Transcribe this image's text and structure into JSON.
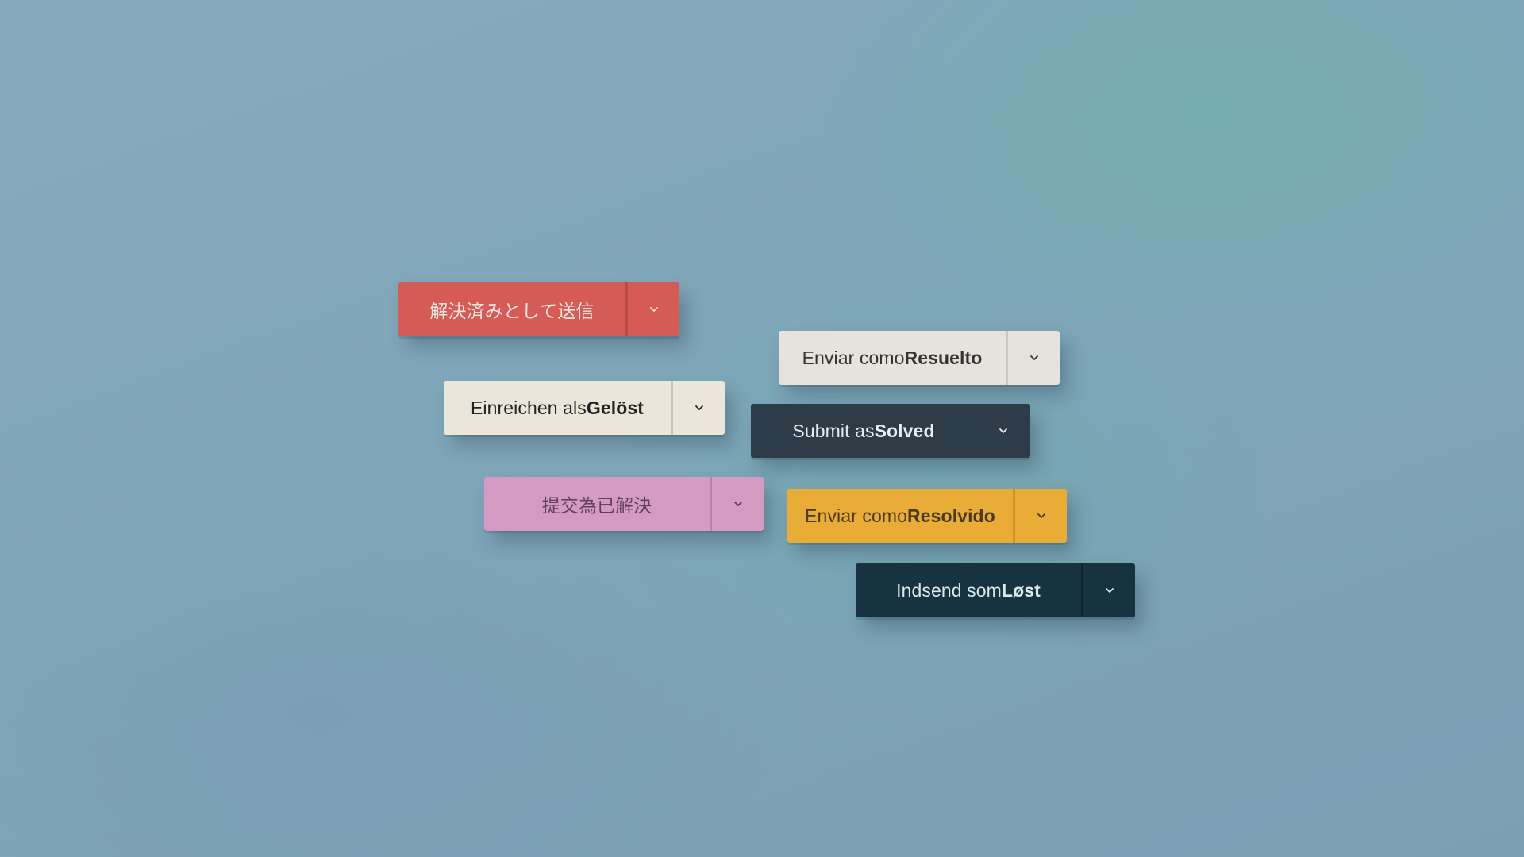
{
  "buttons": [
    {
      "id": "ja",
      "label_prefix": "解決済みとして送信",
      "label_bold": "",
      "color": "#d65a55"
    },
    {
      "id": "es",
      "label_prefix": "Enviar como ",
      "label_bold": "Resuelto",
      "color": "#e6e2dc"
    },
    {
      "id": "de",
      "label_prefix": "Einreichen als ",
      "label_bold": "Gelöst",
      "color": "#ebe6da"
    },
    {
      "id": "en",
      "label_prefix": "Submit as ",
      "label_bold": "Solved",
      "color": "#2d3c47"
    },
    {
      "id": "zh",
      "label_prefix": "提交為已解決",
      "label_bold": "",
      "color": "#d59ac1"
    },
    {
      "id": "pt",
      "label_prefix": "Enviar como ",
      "label_bold": "Resolvido",
      "color": "#e9ac37"
    },
    {
      "id": "da",
      "label_prefix": "Indsend som ",
      "label_bold": "Løst",
      "color": "#173241"
    }
  ],
  "icons": {
    "dropdown": "chevron-down-icon"
  },
  "background": {
    "color": "#7fa7b8"
  }
}
